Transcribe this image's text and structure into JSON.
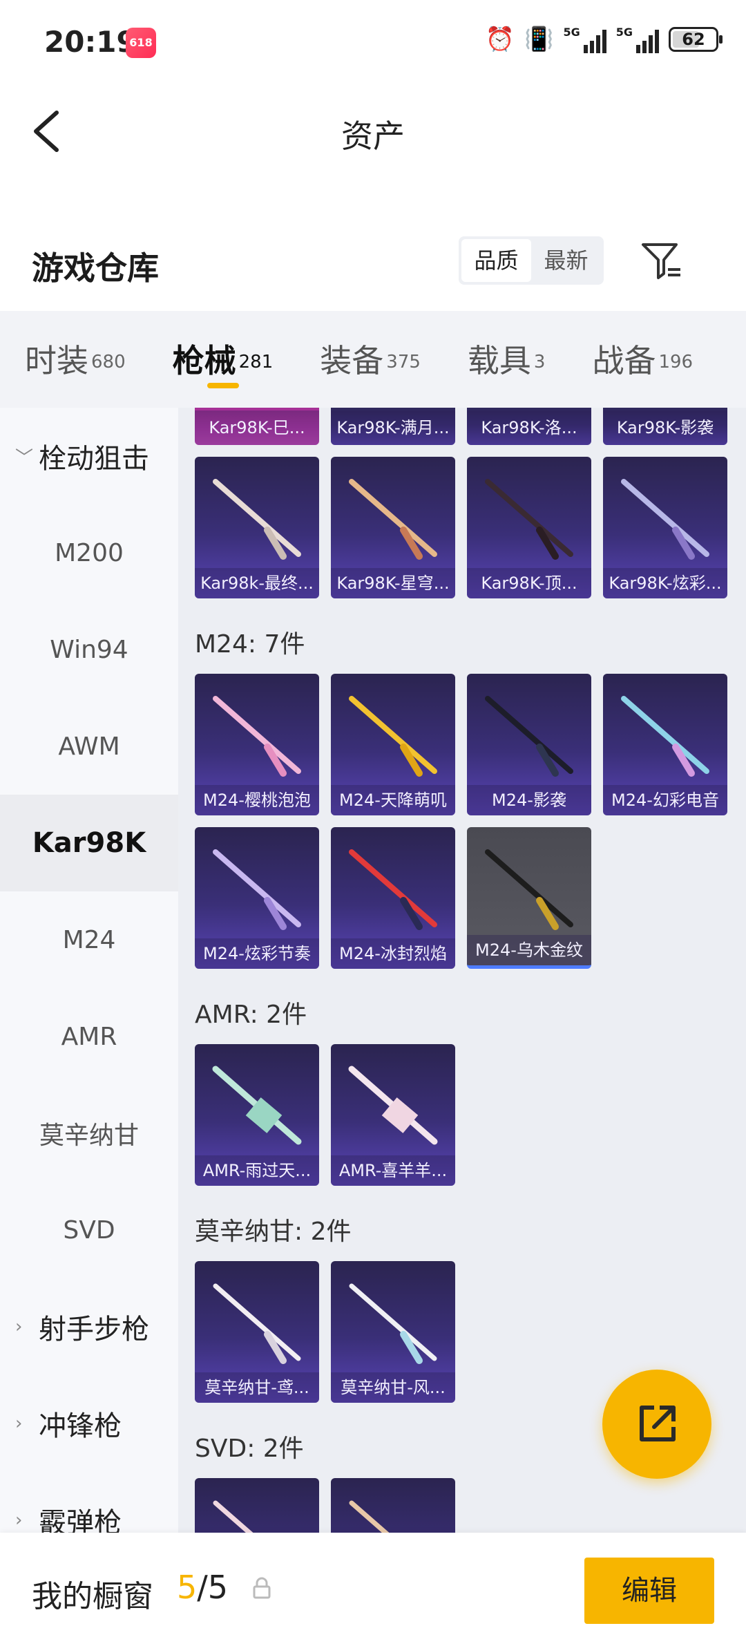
{
  "status": {
    "time": "20:19",
    "app_badge": "618",
    "net1": "5G",
    "net2": "5G",
    "battery": "62"
  },
  "nav": {
    "title": "资产"
  },
  "warehouse": {
    "title": "游戏仓库",
    "sort_quality": "品质",
    "sort_newest": "最新"
  },
  "tabs": [
    {
      "label": "时装",
      "count": "680"
    },
    {
      "label": "枪械",
      "count": "281"
    },
    {
      "label": "装备",
      "count": "375"
    },
    {
      "label": "载具",
      "count": "3"
    },
    {
      "label": "战备",
      "count": "196"
    }
  ],
  "sidebar": {
    "group_bolt": "栓动狙击",
    "items": [
      "M200",
      "Win94",
      "AWM",
      "Kar98K",
      "M24",
      "AMR",
      "莫辛纳甘",
      "SVD"
    ],
    "group_marksman": "射手步枪",
    "group_smg": "冲锋枪",
    "group_shotgun": "霰弹枪"
  },
  "kar98k": {
    "top_row": [
      "Kar98K-巳...",
      "Kar98K-满月...",
      "Kar98K-洛...",
      "Kar98K-影袭"
    ],
    "row2": [
      "Kar98k-最终...",
      "Kar98K-星穹...",
      "Kar98K-顶...",
      "Kar98K-炫彩..."
    ]
  },
  "m24": {
    "header": "M24: 7件",
    "items": [
      "M24-樱桃泡泡",
      "M24-天降萌叽",
      "M24-影袭",
      "M24-幻彩电音",
      "M24-炫彩节奏",
      "M24-冰封烈焰",
      "M24-乌木金纹"
    ]
  },
  "amr": {
    "header": "AMR: 2件",
    "items": [
      "AMR-雨过天...",
      "AMR-喜羊羊..."
    ]
  },
  "mosin": {
    "header": "莫辛纳甘: 2件",
    "items": [
      "莫辛纳甘-鸢...",
      "莫辛纳甘-风..."
    ]
  },
  "svd": {
    "header": "SVD: 2件"
  },
  "bottom": {
    "title": "我的橱窗",
    "count_current": "5",
    "count_total": "/5",
    "edit_label": "编辑"
  },
  "colors": {
    "accent": "#f7b500",
    "card_purple": "#3a2f78",
    "card_pink": "#c23ab3",
    "card_gray": "#55555d"
  }
}
